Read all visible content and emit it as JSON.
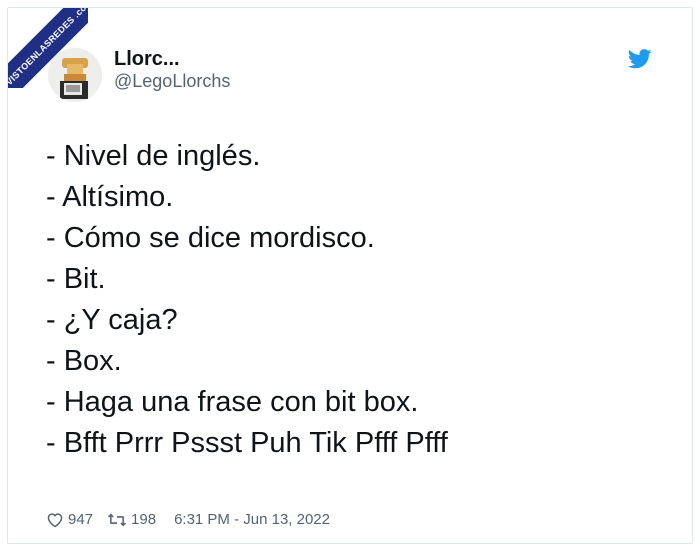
{
  "watermark": "VISTOENLASREDES .com",
  "author": {
    "display_name": "Llorc...",
    "handle": "@LegoLlorchs"
  },
  "tweet": {
    "lines": [
      "- Nivel de inglés.",
      "- Altísimo.",
      "- Cómo se dice mordisco.",
      "- Bit.",
      "- ¿Y caja?",
      "- Box.",
      "- Haga una frase con bit box.",
      "- Bfft Prrr Pssst Puh Tik Pfff Pfff"
    ]
  },
  "footer": {
    "likes": "947",
    "retweets": "198",
    "timestamp": "6:31 PM - Jun 13, 2022"
  },
  "icons": {
    "brand": "twitter-bird-icon",
    "like": "heart-icon",
    "retweet": "retweet-icon"
  },
  "colors": {
    "twitter_blue": "#1d9bf0",
    "muted_text": "#536471",
    "watermark_band": "#1f2f86"
  }
}
